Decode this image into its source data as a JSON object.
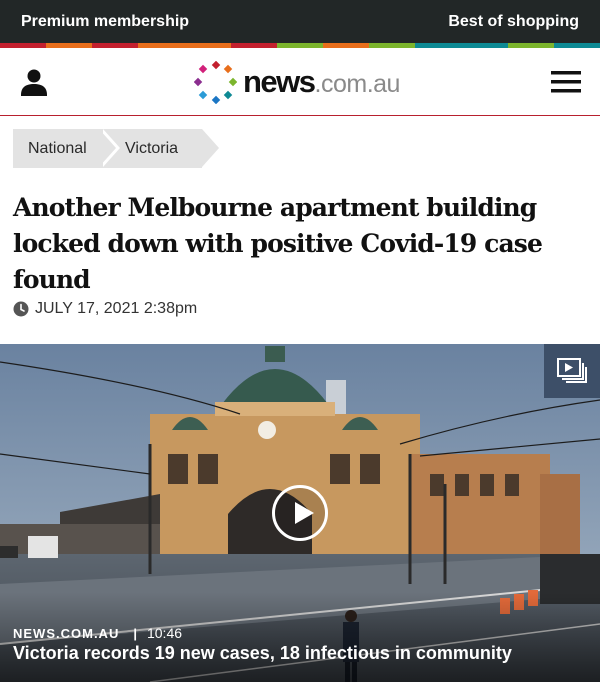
{
  "promo": {
    "left_label": "Premium membership",
    "right_label": "Best of shopping"
  },
  "stripe_colors": [
    "#c3202e",
    "#e86e1b",
    "#c3202e",
    "#e86e1b",
    "#e86e1b",
    "#c3202e",
    "#7cb52d",
    "#e86e1b",
    "#7cb52d",
    "#0e8a94",
    "#0e8a94",
    "#7cb52d",
    "#0e8a94"
  ],
  "header": {
    "logo_main": "news",
    "logo_sub": ".com.au",
    "accent_color": "#b8202e"
  },
  "breadcrumb": {
    "items": [
      {
        "label": "National"
      },
      {
        "label": "Victoria"
      }
    ]
  },
  "article": {
    "headline": "Another Melbourne apartment building locked down with positive Covid-19 case found",
    "date": "JULY 17, 2021 2:38pm"
  },
  "video": {
    "source": "NEWS.COM.AU",
    "separator": "|",
    "time": "10:46",
    "title": "Victoria records 19 new cases, 18 infectious in community",
    "icons": [
      "gallery-icon",
      "play-icon"
    ]
  }
}
